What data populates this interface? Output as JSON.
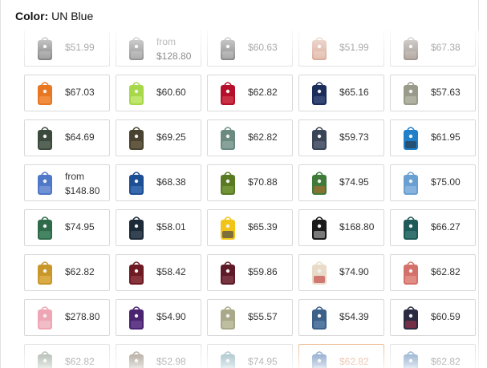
{
  "header": {
    "label": "Color:",
    "value": "UN Blue"
  },
  "rows": [
    [
      {
        "price": "$51.99",
        "color": "#3b3b3b",
        "accent": "#8a8a8a"
      },
      {
        "price": "from",
        "price2": "$128.80",
        "color": "#555555",
        "accent": "#999999"
      },
      {
        "price": "$60.63",
        "color": "#444444",
        "accent": "#9a9a9a"
      },
      {
        "price": "$51.99",
        "color": "#c47b5d",
        "accent": "#e2b49e"
      },
      {
        "price": "$67.38",
        "color": "#6a5a50",
        "accent": "#a08e80"
      }
    ],
    [
      {
        "price": "$67.03",
        "color": "#e87722",
        "accent": "#f6a155"
      },
      {
        "price": "$60.60",
        "color": "#a6d84a",
        "accent": "#d6f28b"
      },
      {
        "price": "$62.82",
        "color": "#b5102b",
        "accent": "#d84a5b"
      },
      {
        "price": "$65.16",
        "color": "#1b2e5a",
        "accent": "#4a5f8c"
      },
      {
        "price": "$57.63",
        "color": "#9a9a8a",
        "accent": "#c4c4b4"
      }
    ],
    [
      {
        "price": "$64.69",
        "color": "#3c4a3e",
        "accent": "#6d7a6e"
      },
      {
        "price": "$69.25",
        "color": "#4a4230",
        "accent": "#7a7050"
      },
      {
        "price": "$62.82",
        "color": "#6b8a80",
        "accent": "#9fb7ae"
      },
      {
        "price": "$59.73",
        "color": "#3a4658",
        "accent": "#6a7688"
      },
      {
        "price": "$61.95",
        "color": "#1f7fc9",
        "accent": "#2b2b2b"
      }
    ],
    [
      {
        "price": "from",
        "price2": "$148.80",
        "color": "#4f78c8",
        "accent": "#8ea8e0"
      },
      {
        "price": "$68.38",
        "color": "#1d4f94",
        "accent": "#4d7fc4"
      },
      {
        "price": "$70.88",
        "color": "#5a7a22",
        "accent": "#88a848"
      },
      {
        "price": "$74.95",
        "color": "#3f7a3a",
        "accent": "#c06a2a"
      },
      {
        "price": "$75.00",
        "color": "#6a9fd2",
        "accent": "#9fc4e8"
      }
    ],
    [
      {
        "price": "$74.95",
        "color": "#2f6a4a",
        "accent": "#5a9a78"
      },
      {
        "price": "$58.01",
        "color": "#1c2a38",
        "accent": "#4a5a68"
      },
      {
        "price": "$65.39",
        "color": "#f2c418",
        "accent": "#1d2a55"
      },
      {
        "price": "$168.80",
        "color": "#1a1a1a",
        "accent": "#c8c8c8"
      },
      {
        "price": "$66.27",
        "color": "#1e5a58",
        "accent": "#4a8a88"
      }
    ],
    [
      {
        "price": "$62.82",
        "color": "#c9962a",
        "accent": "#e8c060"
      },
      {
        "price": "$58.42",
        "color": "#6e1a22",
        "accent": "#9e4a52"
      },
      {
        "price": "$59.86",
        "color": "#5e1a26",
        "accent": "#8e4a56"
      },
      {
        "price": "$74.90",
        "color": "#e8dcc8",
        "accent": "#c0272d"
      },
      {
        "price": "$62.82",
        "color": "#d4716a",
        "accent": "#eda39c"
      }
    ],
    [
      {
        "price": "$278.80",
        "color": "#eea6b4",
        "accent": "#f6cdd5"
      },
      {
        "price": "$54.90",
        "color": "#4a2470",
        "accent": "#7a54a0"
      },
      {
        "price": "$55.57",
        "color": "#a9a98a",
        "accent": "#d0d0b4"
      },
      {
        "price": "$54.39",
        "color": "#3c6088",
        "accent": "#6e90b8"
      },
      {
        "price": "$60.59",
        "color": "#2a2a40",
        "accent": "#b0324a"
      }
    ],
    [
      {
        "price": "$62.82",
        "color": "#7a8a7a",
        "accent": "#aab4aa"
      },
      {
        "price": "$52.98",
        "color": "#7a6a58",
        "accent": "#a89888"
      },
      {
        "price": "$74.95",
        "color": "#6a9aa8",
        "accent": "#a0c4ce"
      },
      {
        "price": "$62.82",
        "color": "#3a6aa8",
        "accent": "#8fb0d8",
        "selected": true
      },
      {
        "price": "$62.82",
        "color": "#4a7ab0",
        "accent": "#90b4d8"
      }
    ]
  ]
}
